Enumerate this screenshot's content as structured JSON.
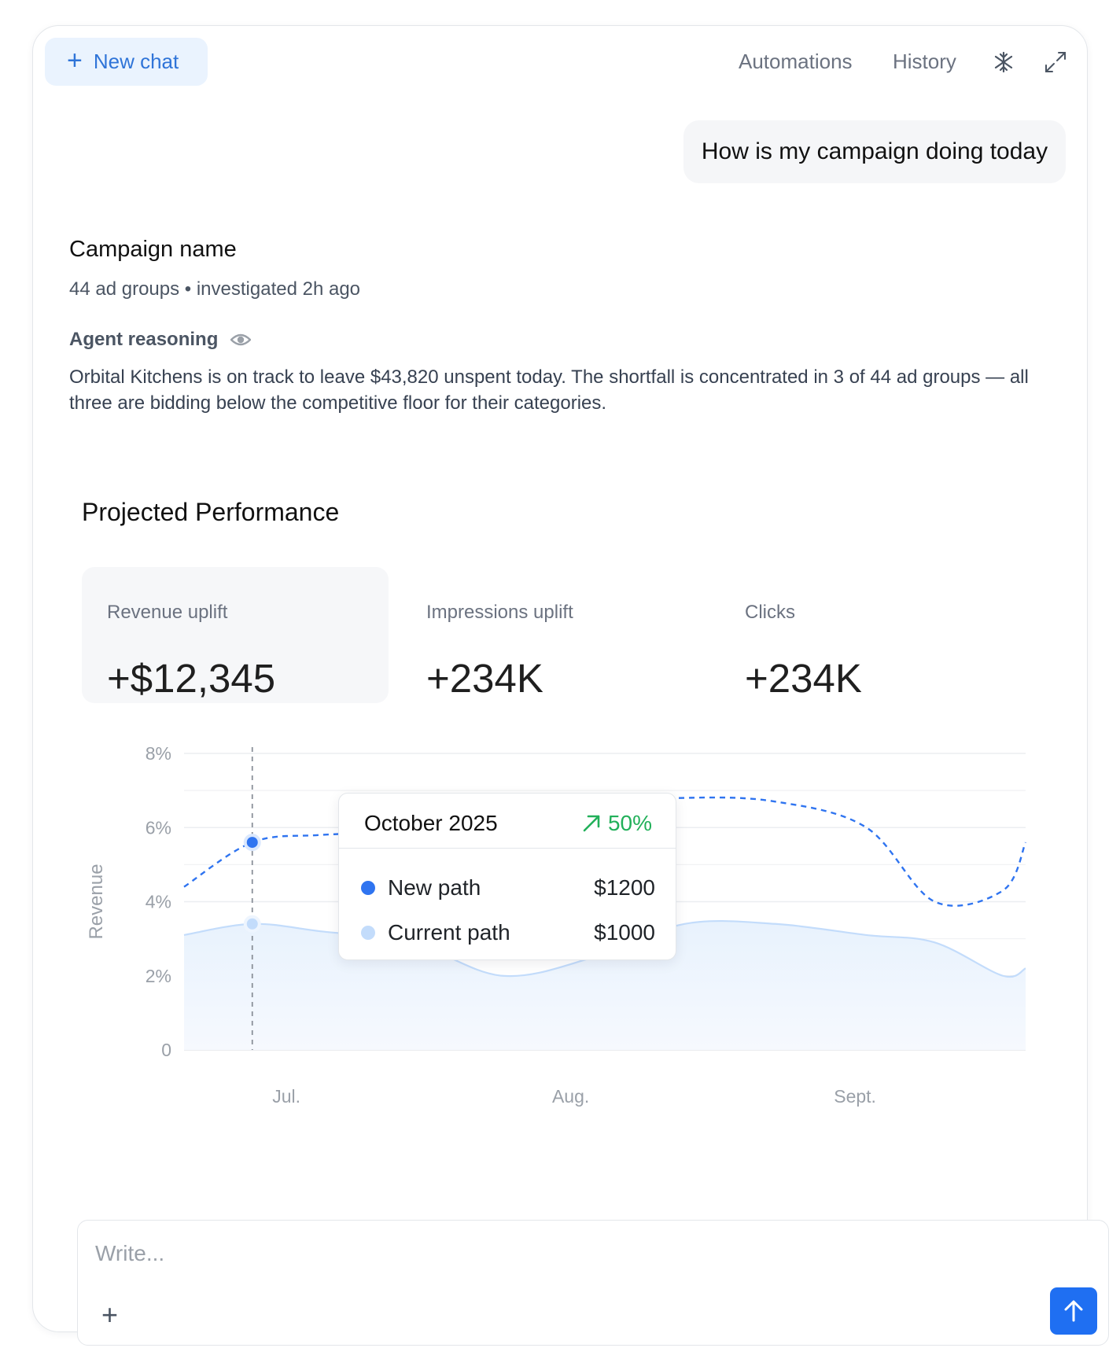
{
  "toolbar": {
    "new_chat_label": "New chat",
    "automations_label": "Automations",
    "history_label": "History"
  },
  "chat": {
    "user_message": "How is my campaign doing today"
  },
  "campaign": {
    "title": "Campaign name",
    "subtitle": "44 ad groups • investigated 2h ago",
    "reasoning_title": "Agent reasoning",
    "reasoning_text": "Orbital Kitchens is on track to leave $43,820 unspent today. The shortfall is concentrated in 3 of 44 ad groups — all three are bidding below the competitive floor for their categories."
  },
  "performance": {
    "title": "Projected Performance",
    "metrics": [
      {
        "label": "Revenue uplift",
        "value": "+$12,345"
      },
      {
        "label": "Impressions uplift",
        "value": "+234K"
      },
      {
        "label": "Clicks",
        "value": "+234K"
      }
    ]
  },
  "tooltip": {
    "date": "October 2025",
    "change": "50%",
    "rows": [
      {
        "name": "New path",
        "value": "$1200"
      },
      {
        "name": "Current path",
        "value": "$1000"
      }
    ]
  },
  "composer": {
    "placeholder": "Write..."
  },
  "colors": {
    "accent": "#1f6ff2",
    "new_path": "#2f74f0",
    "current_path": "#c3dcfb",
    "positive": "#22b05a"
  },
  "chart_data": {
    "type": "line",
    "xlabel": "",
    "ylabel": "Revenue",
    "y_ticks": [
      "0",
      "2%",
      "4%",
      "6%",
      "8%"
    ],
    "ylim": [
      0,
      8
    ],
    "x_ticks": [
      "Jul.",
      "Aug.",
      "Sept."
    ],
    "x": [
      0,
      0.3,
      0.6,
      1.0,
      1.4,
      1.8,
      2.2,
      2.6,
      3.0,
      3.3,
      3.6,
      3.7
    ],
    "series": [
      {
        "name": "New path",
        "style": "dashed",
        "values": [
          4.4,
          5.6,
          5.8,
          5.9,
          6.2,
          6.6,
          6.8,
          6.7,
          6.0,
          4.0,
          4.3,
          5.6
        ]
      },
      {
        "name": "Current path",
        "style": "area",
        "values": [
          3.1,
          3.4,
          3.2,
          2.9,
          2.0,
          2.5,
          3.4,
          3.4,
          3.1,
          2.9,
          2.0,
          2.2
        ]
      }
    ],
    "grid": true,
    "highlight_x": 0.3
  }
}
